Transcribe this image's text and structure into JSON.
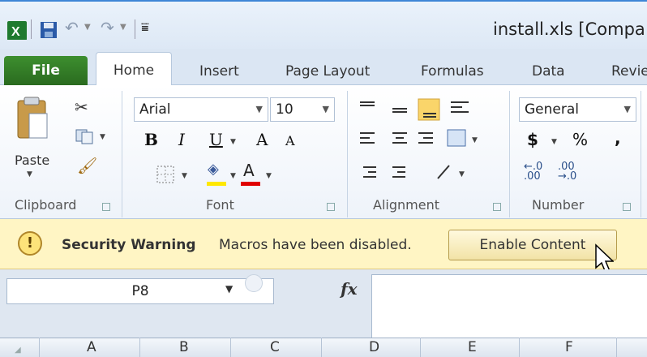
{
  "window": {
    "title": "install.xls  [Compa"
  },
  "tabs": {
    "file": "File",
    "home": "Home",
    "insert": "Insert",
    "page_layout": "Page Layout",
    "formulas": "Formulas",
    "data": "Data",
    "review": "Revie"
  },
  "clipboard": {
    "paste_label": "Paste",
    "group_label": "Clipboard"
  },
  "font": {
    "name": "Arial",
    "size": "10",
    "bold": "B",
    "italic": "I",
    "underline": "U",
    "grow": "A",
    "shrink": "A",
    "color_letter": "A",
    "group_label": "Font"
  },
  "alignment": {
    "group_label": "Alignment"
  },
  "number": {
    "format": "General",
    "currency": "$",
    "percent": "%",
    "comma": ",",
    "group_label": "Number"
  },
  "security": {
    "title": "Security Warning",
    "message": "Macros have been disabled.",
    "button": "Enable Content"
  },
  "formula_bar": {
    "name_box": "P8",
    "fx": "fx"
  },
  "columns": [
    "A",
    "B",
    "C",
    "D",
    "E",
    "F"
  ],
  "colors": {
    "file_tab": "#2f7a25",
    "warning_bar": "#fff5c4",
    "font_color_bar": "#e00000",
    "highlight_bar": "#ffe800"
  }
}
